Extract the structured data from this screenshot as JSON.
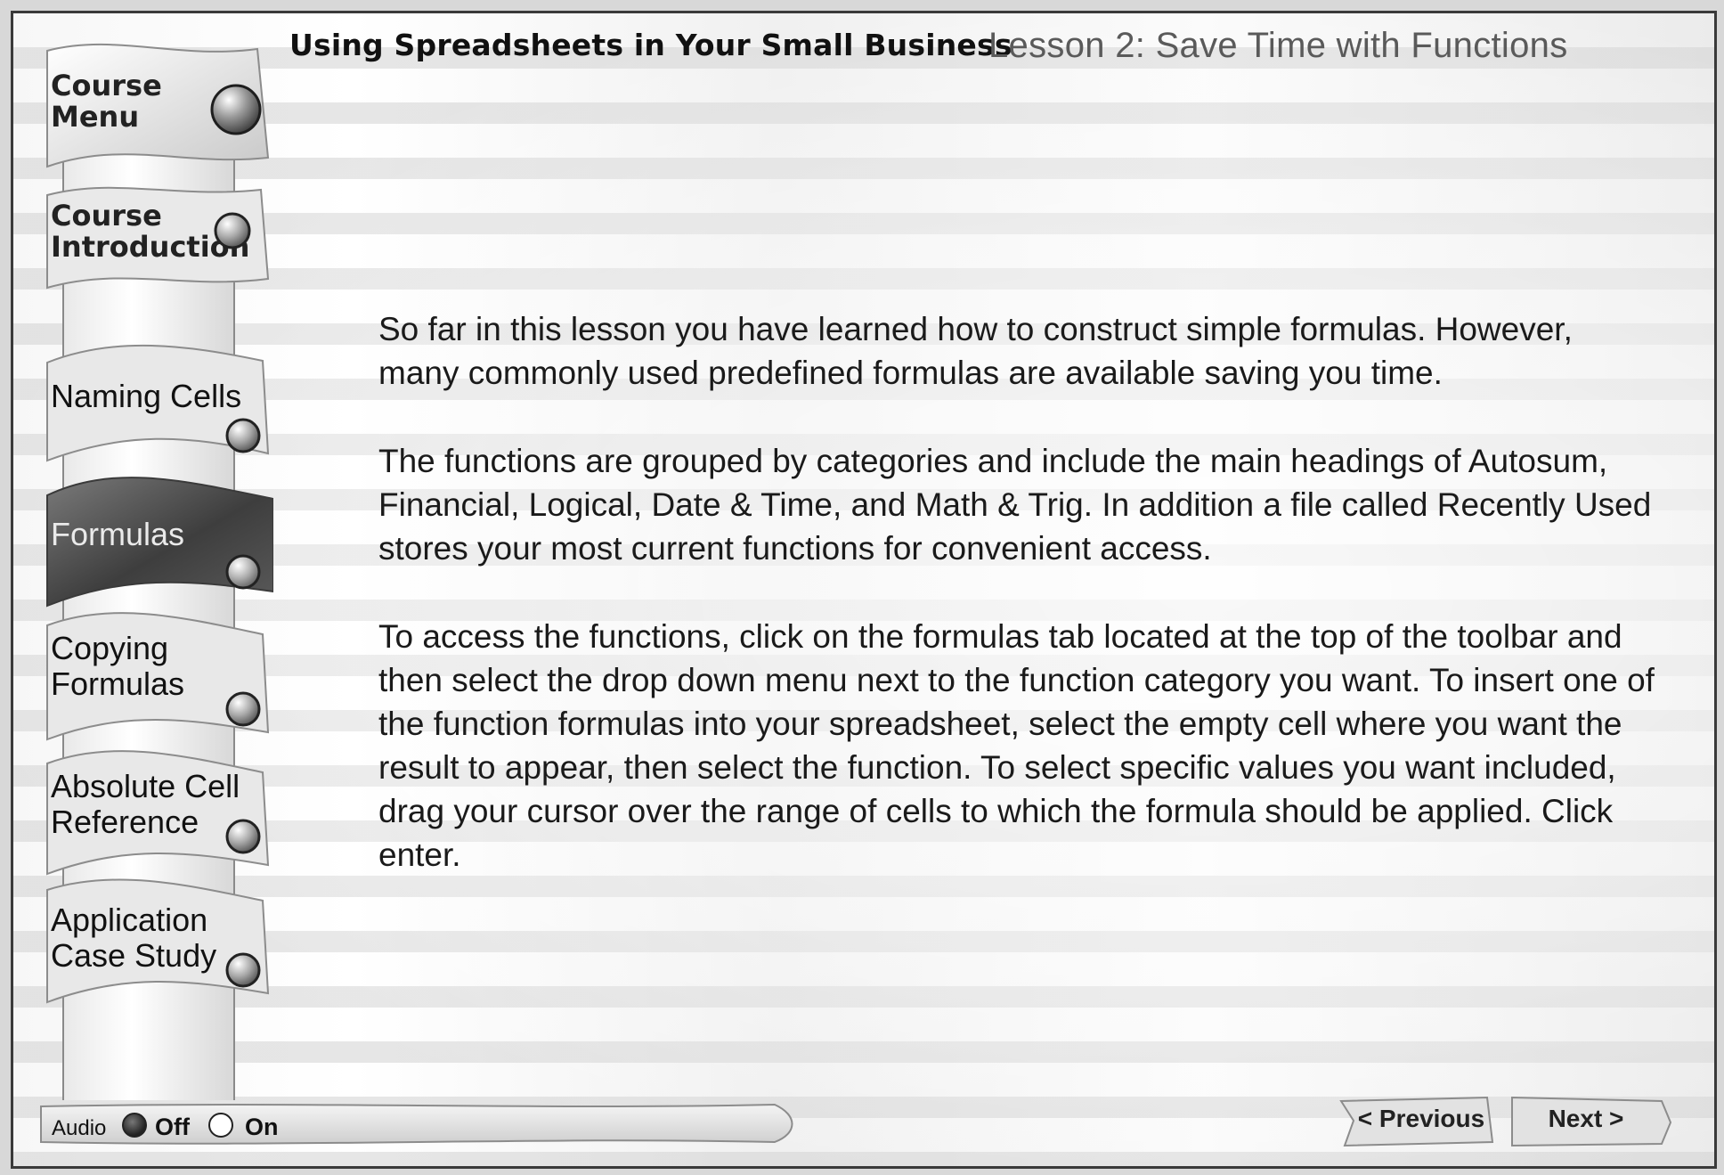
{
  "header": {
    "course_title": "Using Spreadsheets in Your Small Business",
    "lesson_title": "Lesson 2: Save Time with Functions"
  },
  "sidebar": {
    "items": [
      {
        "label_line1": "Course",
        "label_line2": "Menu",
        "active": false
      },
      {
        "label_line1": "Course",
        "label_line2": "Introduction",
        "active": false
      },
      {
        "label_line1": "Naming Cells",
        "label_line2": "",
        "active": false
      },
      {
        "label_line1": "Formulas",
        "label_line2": "",
        "active": true
      },
      {
        "label_line1": "Copying",
        "label_line2": "Formulas",
        "active": false
      },
      {
        "label_line1": "Absolute Cell",
        "label_line2": "Reference",
        "active": false
      },
      {
        "label_line1": "Application",
        "label_line2": "Case Study",
        "active": false
      }
    ]
  },
  "content": {
    "paragraph1": "So far in this lesson  you have learned how to construct simple formulas. However, many  commonly used  predefined formulas are available saving you time.",
    "paragraph2": "The functions are grouped by categories and include the main headings of Autosum, Financial, Logical, Date & Time, and Math & Trig. In addition a file called Recently Used stores your most current functions for convenient access.",
    "paragraph3": "To access the functions, click on the formulas tab located at the top of the toolbar and then select the drop down menu next to the function category you want. To insert one of the function formulas into your spreadsheet, select the empty cell  where you want the result to appear, then select the function. To select specific values you want included, drag your cursor over the range of cells to which the formula should be applied.  Click enter."
  },
  "footer": {
    "audio_label": "Audio",
    "audio_off": "Off",
    "audio_on": "On",
    "audio_selected": "Off",
    "previous_label": "< Previous",
    "next_label": "Next >"
  },
  "colors": {
    "active_tab": "#4a4a4a",
    "tab": "#e6e6e6",
    "text": "#1a1a1a"
  }
}
